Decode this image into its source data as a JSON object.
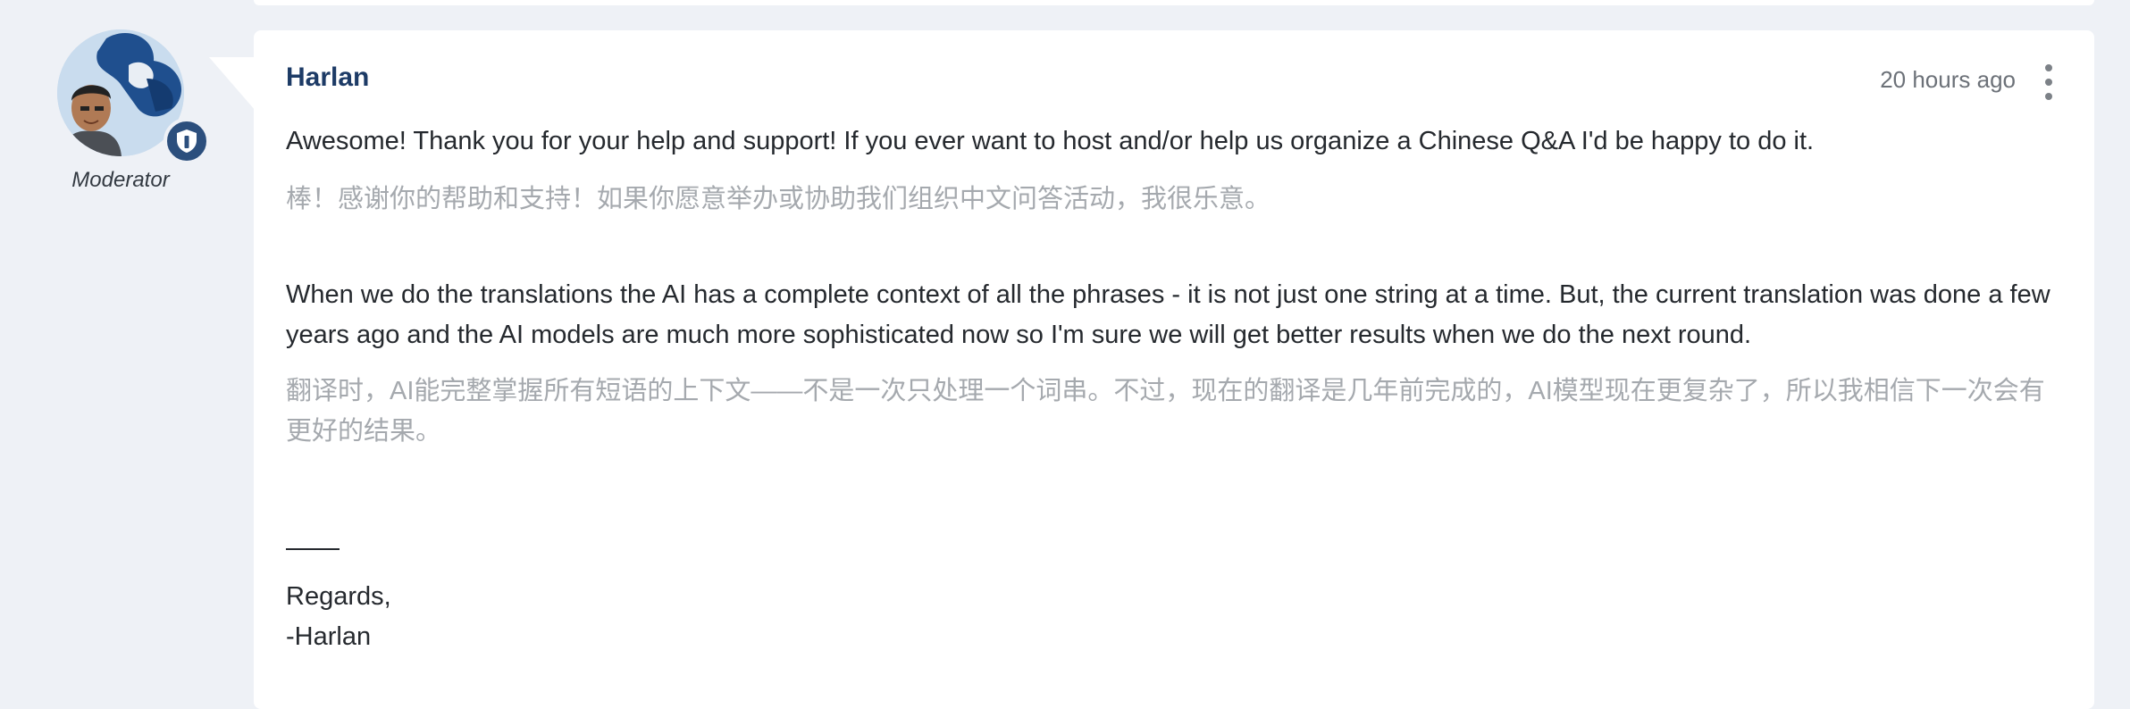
{
  "post": {
    "author": {
      "name": "Harlan",
      "role": "Moderator"
    },
    "timestamp": "20 hours ago",
    "menu_icon": "more-vertical-icon",
    "body": {
      "paragraph1_en": "Awesome! Thank you for your help and support! If you ever want to host and/or help us organize a Chinese Q&A I'd be happy to do it.",
      "paragraph1_zh": "棒！感谢你的帮助和支持！如果你愿意举办或协助我们组织中文问答活动，我很乐意。",
      "paragraph2_en": "When we do the translations the AI has a complete context of all the phrases - it is not just one string at a time. But, the current translation was done a few years ago and the AI models are much more sophisticated now so I'm sure we will get better results when we do the next round.",
      "paragraph2_zh": "翻译时，AI能完整掌握所有短语的上下文——不是一次只处理一个词串。不过，现在的翻译是几年前完成的，AI模型现在更复杂了，所以我相信下一次会有更好的结果。",
      "signature_greeting": "Regards,",
      "signature_name": "-Harlan"
    }
  },
  "colors": {
    "page_background": "#eef1f6",
    "card_background": "#ffffff",
    "author_name": "#1d3b66",
    "translation_text": "#a5a9ae",
    "body_text": "#25292e",
    "badge": "#2c4f7d"
  }
}
